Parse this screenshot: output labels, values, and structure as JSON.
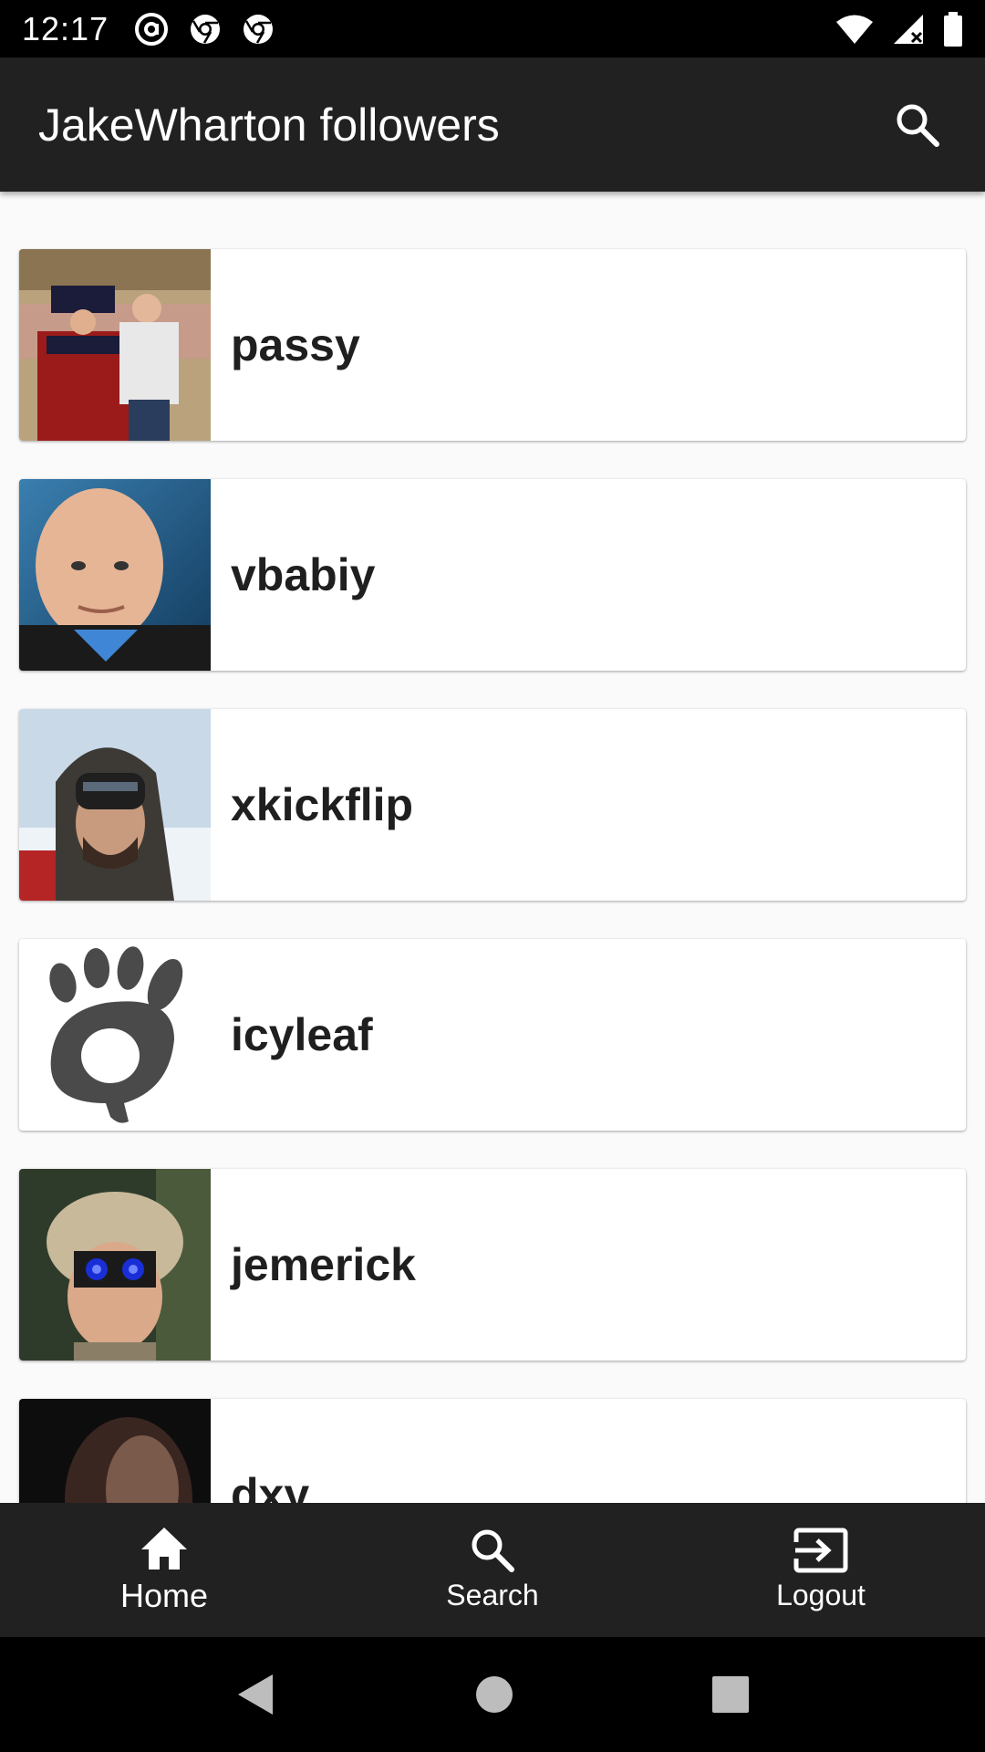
{
  "status_bar": {
    "time": "12:17",
    "icons": [
      "at-sign-icon",
      "chrome-icon",
      "chrome-icon",
      "wifi-icon",
      "signal-icon",
      "battery-icon"
    ]
  },
  "app_bar": {
    "title": "JakeWharton followers",
    "search_icon": "search-icon"
  },
  "followers": [
    {
      "username": "passy"
    },
    {
      "username": "vbabiy"
    },
    {
      "username": "xkickflip"
    },
    {
      "username": "icyleaf"
    },
    {
      "username": "jemerick"
    },
    {
      "username": "dxy"
    }
  ],
  "bottom_nav": {
    "items": [
      {
        "label": "Home",
        "icon": "home-icon",
        "active": true
      },
      {
        "label": "Search",
        "icon": "search-icon",
        "active": false
      },
      {
        "label": "Logout",
        "icon": "logout-icon",
        "active": false
      }
    ]
  },
  "system_nav": [
    "back-icon",
    "home-circle-icon",
    "recents-icon"
  ],
  "colors": {
    "app_bar": "#212121",
    "bottom_nav": "#212121",
    "background": "#fafafa",
    "card": "#ffffff",
    "text": "#1f1f1f"
  }
}
